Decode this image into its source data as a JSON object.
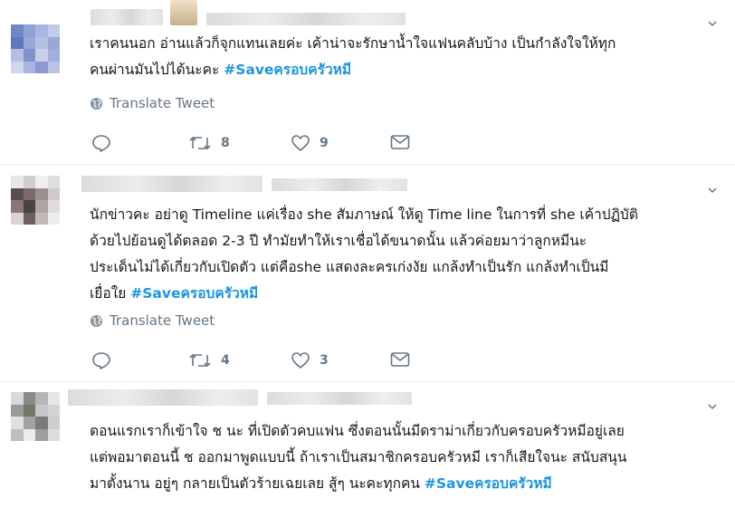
{
  "tweets": [
    {
      "text": "เราคนนอก อ่านแล้วก็จุกแทนเลยค่ะ เค้าน่าจะรักษาน้ำใจแฟนคลับบ้าง เป็นกำลังใจให้ทุก\nคนผ่านมันไปได้นะคะ ",
      "hashtag": "#Saveครอบครัวหมี",
      "translate_label": "Translate Tweet",
      "reply_count": "",
      "retweet_count": "8",
      "like_count": "9"
    },
    {
      "text": "นักข่าวคะ อย่าดู Timeline แค่เรื่อง she สัมภาษณ์ ให้ดู Time line ในการที่ she เค้าปฏิบัติ\nด้วยไปย้อนดูได้ตลอด 2-3 ปี ทำมัยทำให้เราเชื่อได้ขนาดนั้น แล้วค่อยมาว่าลูกหมีนะ\nประเด็นไม่ได้เกี่ยวกับเปิดตัว แต่คือshe แสดงละครเก่งงัย แกล้งทำเป็นรัก แกล้งทำเป็นมี\nเยื่อใย  ",
      "hashtag": "#Saveครอบครัวหมี",
      "translate_label": "Translate Tweet",
      "reply_count": "",
      "retweet_count": "4",
      "like_count": "3"
    },
    {
      "text": "ตอนแรกเราก็เข้าใจ ช นะ ที่เปิดตัวคบแฟน ซึ่งตอนนั้นมีดราม่าเกี่ยวกับครอบครัวหมีอยู่เลย\nแต่พอมาตอนนี้ ช ออกมาพูดแบบนี้ ถ้าเราเป็นสมาชิกครอบครัวหมี เราก็เสียใจนะ  สนับสนุน\nมาตั้งนาน อยู่ๆ กลายเป็นตัวร้ายเฉยเลย  สู้ๆ นะคะทุกคน ",
      "hashtag": "#Saveครอบครัวหมี"
    }
  ],
  "icons": {
    "chevron": "chevron-down-icon",
    "globe": "globe-icon",
    "reply": "reply-icon",
    "retweet": "retweet-icon",
    "like": "heart-icon",
    "message": "envelope-icon"
  },
  "colors": {
    "text": "#14171a",
    "muted": "#657786",
    "hashtag": "#1b95e0",
    "divider": "#e6ecf0"
  }
}
